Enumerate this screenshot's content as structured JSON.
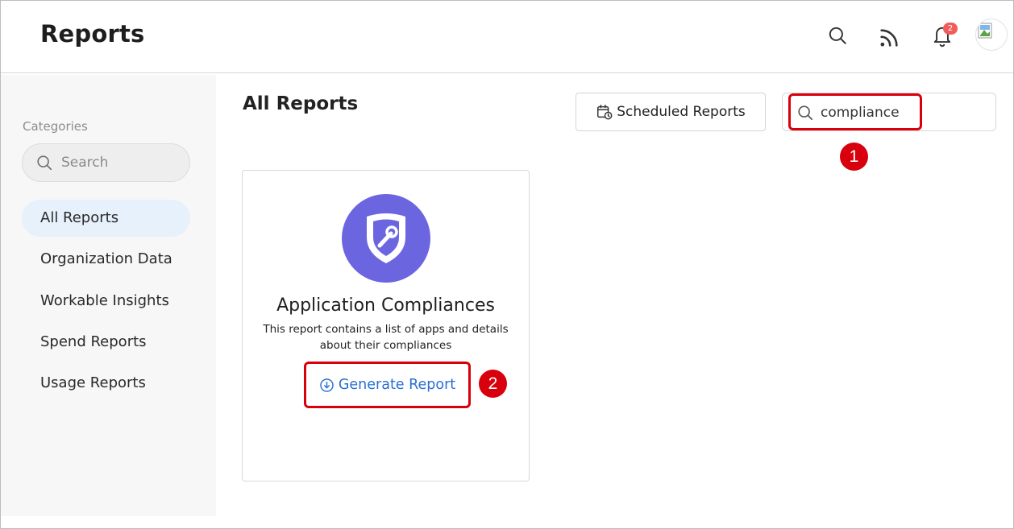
{
  "header": {
    "title": "Reports",
    "notification_count": "2",
    "icons": [
      "search-icon",
      "rss-feed-icon",
      "bell-icon",
      "avatar-image"
    ]
  },
  "sidebar": {
    "categories_label": "Categories",
    "search_placeholder": "Search",
    "items": [
      {
        "label": "All Reports",
        "active": true
      },
      {
        "label": "Organization Data",
        "active": false
      },
      {
        "label": "Workable Insights",
        "active": false
      },
      {
        "label": "Spend Reports",
        "active": false
      },
      {
        "label": "Usage Reports",
        "active": false
      }
    ]
  },
  "main": {
    "title": "All Reports",
    "scheduled_button_label": "Scheduled Reports",
    "search_value": "compliance",
    "card": {
      "icon": "shield-gauge-icon",
      "title": "Application Compliances",
      "description": "This report contains a list of apps and details about their compliances",
      "action_label": "Generate Report"
    }
  },
  "annotations": {
    "step_1": "1",
    "step_2": "2"
  },
  "colors": {
    "accent": "#6b66e0",
    "link": "#2a6fd0",
    "highlight": "#d8000c",
    "badge": "#f25b5b",
    "active_item_bg": "#e7f1fb"
  }
}
